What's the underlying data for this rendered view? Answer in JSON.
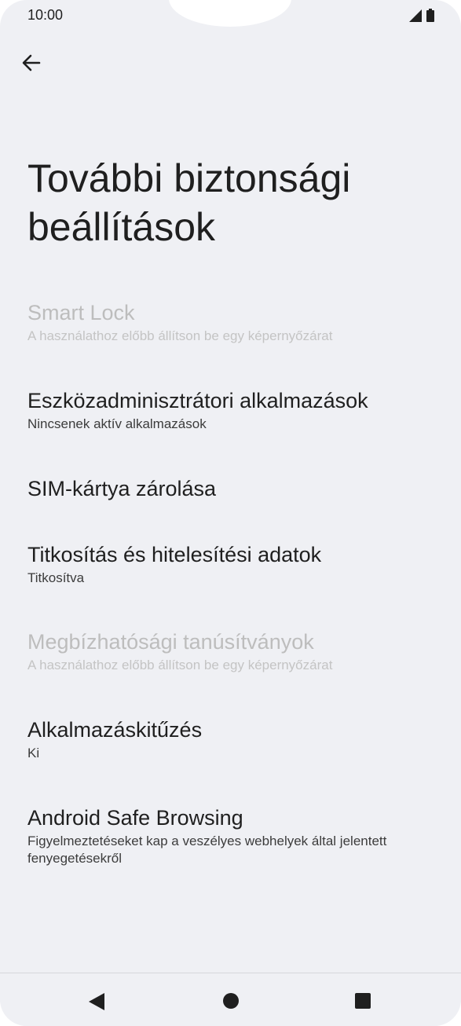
{
  "status_bar": {
    "time": "10:00"
  },
  "title": "További biztonsági beállítások",
  "items": [
    {
      "title": "Smart Lock",
      "subtitle": "A használathoz előbb állítson be egy képernyőzárat",
      "enabled": false
    },
    {
      "title": "Eszközadminisztrátori alkalmazások",
      "subtitle": "Nincsenek aktív alkalmazások",
      "enabled": true
    },
    {
      "title": "SIM-kártya zárolása",
      "subtitle": "",
      "enabled": true
    },
    {
      "title": "Titkosítás és hitelesítési adatok",
      "subtitle": "Titkosítva",
      "enabled": true
    },
    {
      "title": "Megbízhatósági tanúsítványok",
      "subtitle": "A használathoz előbb állítson be egy képernyőzárat",
      "enabled": false
    },
    {
      "title": "Alkalmazáskitűzés",
      "subtitle": "Ki",
      "enabled": true
    },
    {
      "title": "Android Safe Browsing",
      "subtitle": "Figyelmeztetéseket kap a veszélyes webhelyek által jelentett fenyegetésekről",
      "enabled": true
    }
  ],
  "icons": {
    "back": "arrow-back-icon",
    "signal": "signal-icon",
    "battery": "battery-icon",
    "nav_back": "triangle-back-icon",
    "nav_home": "circle-home-icon",
    "nav_recents": "square-recents-icon"
  }
}
